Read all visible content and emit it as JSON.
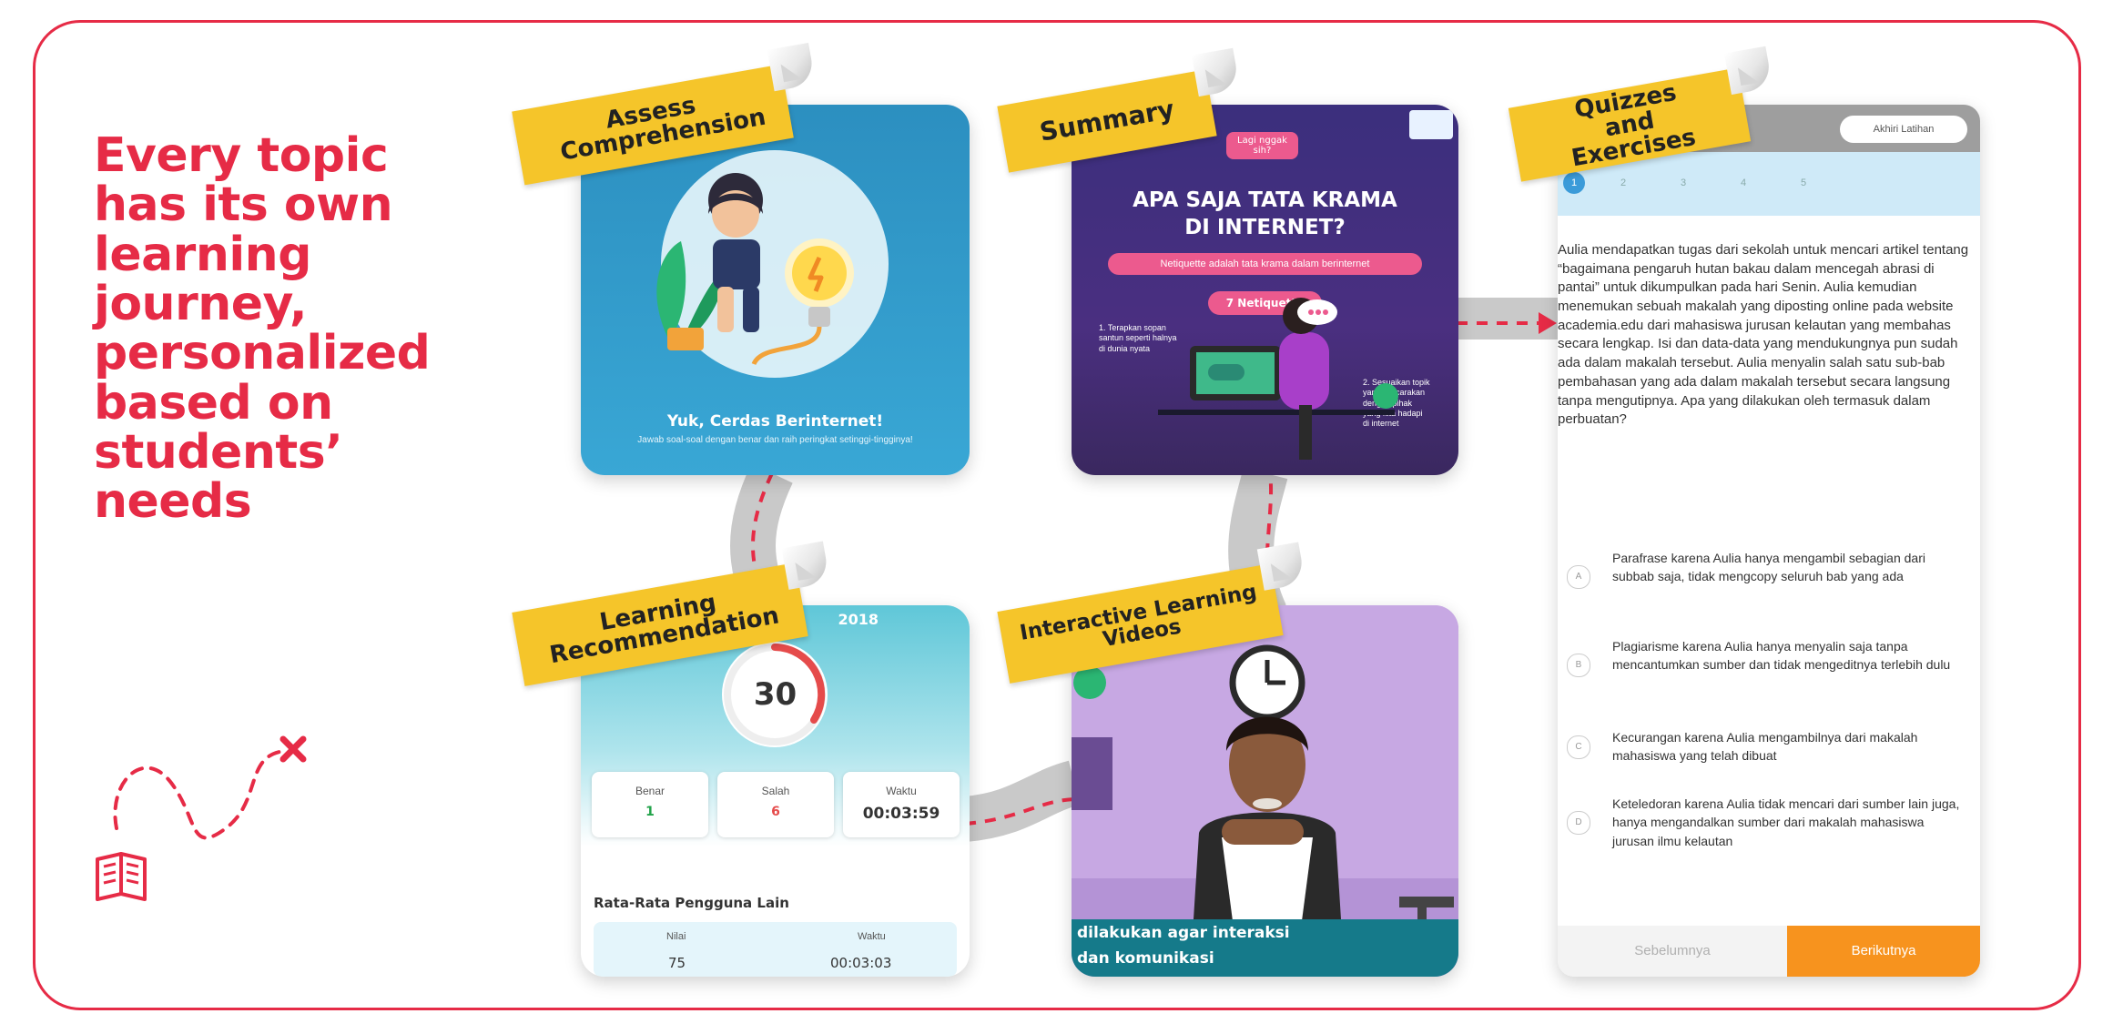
{
  "headline": "Every topic has its own learning journey, personalized based on students’ needs",
  "tags": {
    "assess": "Assess Comprehension",
    "summary": "Summary",
    "quizzes": "Quizzes and Exercises",
    "recommendation": "Learning Recommendation",
    "videos": "Interactive Learning Videos"
  },
  "assess": {
    "title": "Yuk, Cerdas Berinternet!",
    "subtitle": "Jawab soal-soal dengan benar dan raih peringkat setinggi-tingginya!"
  },
  "summary": {
    "bubble": "Lagi nggak sih?",
    "title_line1": "APA SAJA TATA KRAMA",
    "title_line2": "DI INTERNET?",
    "pill": "Netiquette adalah tata krama dalam berinternet",
    "pill2": "7 Netiquette",
    "note1": "1. Terapkan sopan santun seperti halnya di dunia nyata",
    "note2": "2. Sesuaikan topik yang dibicarakan dengan pihak yang kita hadapi di internet"
  },
  "recommendation": {
    "banner": "2018",
    "score": "30",
    "stats": [
      {
        "label": "Benar",
        "value": "1",
        "color": "#22a34a"
      },
      {
        "label": "Salah",
        "value": "6",
        "color": "#e54b4b"
      },
      {
        "label": "Waktu",
        "value": "00:03:59",
        "color": "#333333"
      }
    ],
    "others_title": "Rata-Rata Pengguna Lain",
    "others_headers": [
      "Nilai",
      "Waktu"
    ],
    "others_values": [
      "75",
      "00:03:03"
    ]
  },
  "video": {
    "caption_line1": "dilakukan agar interaksi",
    "caption_line2": "dan komunikasi"
  },
  "quiz": {
    "end_button": "Akhiri Latihan",
    "numbers": [
      "1",
      "2",
      "3",
      "4",
      "5"
    ],
    "question": "Aulia mendapatkan tugas dari sekolah untuk mencari artikel tentang “bagaimana pengaruh hutan bakau dalam mencegah abrasi di pantai” untuk dikumpulkan pada hari Senin. Aulia kemudian menemukan sebuah makalah yang diposting online pada website academia.edu dari mahasiswa jurusan kelautan yang membahas secara lengkap. Isi dan data-data yang mendukungnya pun sudah ada dalam makalah tersebut. Aulia menyalin salah satu sub-bab pembahasan yang ada dalam makalah tersebut secara langsung tanpa mengutipnya. Apa yang dilakukan oleh termasuk dalam perbuatan?",
    "options": [
      {
        "letter": "A",
        "text": "Parafrase karena Aulia hanya mengambil sebagian dari subbab saja, tidak mengcopy seluruh bab yang ada"
      },
      {
        "letter": "B",
        "text": "Plagiarisme karena Aulia hanya menyalin saja tanpa mencantumkan sumber dan tidak mengeditnya terlebih dulu"
      },
      {
        "letter": "C",
        "text": "Kecurangan karena Aulia mengambilnya dari makalah mahasiswa yang telah dibuat"
      },
      {
        "letter": "D",
        "text": "Keteledoran karena Aulia tidak mencari dari sumber lain juga, hanya mengandalkan sumber dari makalah mahasiswa jurusan ilmu kelautan"
      }
    ],
    "prev_button": "Sebelumnya",
    "next_button": "Berikutnya"
  },
  "colors": {
    "brand_red": "#e62b46",
    "tag_yellow": "#f5c52a",
    "next_orange": "#f7931e",
    "road_gray": "#c9c9c9"
  }
}
